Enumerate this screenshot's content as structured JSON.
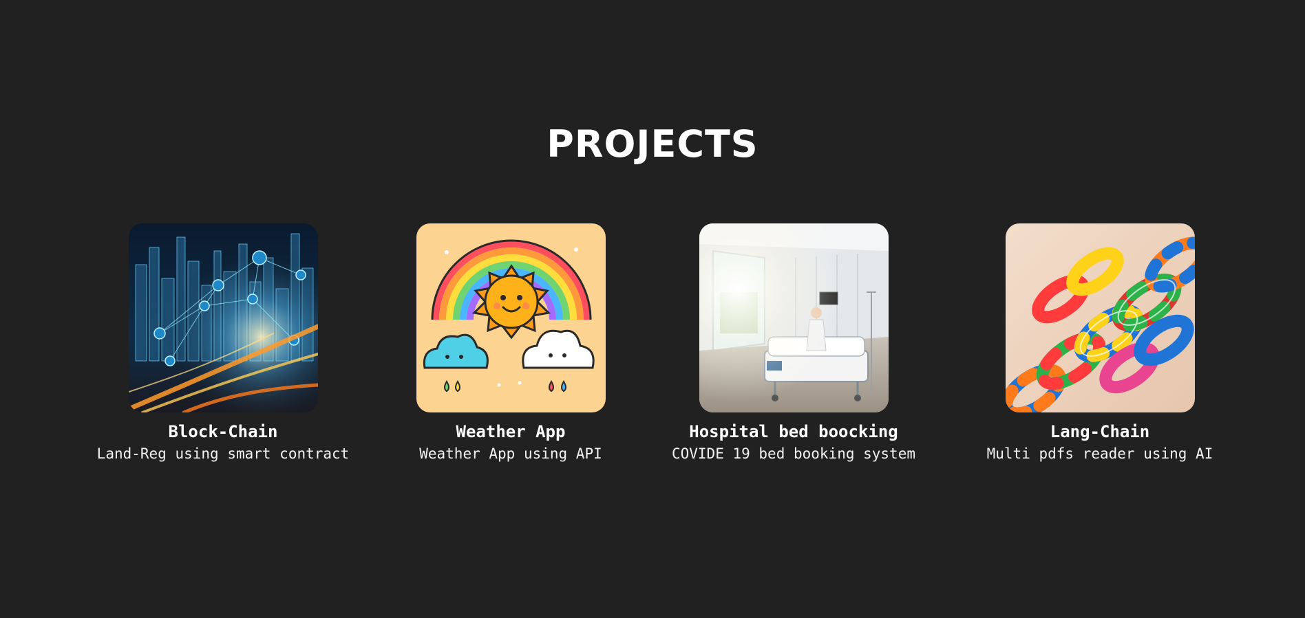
{
  "section": {
    "title": "PROJECTS"
  },
  "projects": [
    {
      "title": "Block-Chain",
      "description": "Land-Reg using smart contract",
      "image_icon": "futuristic-city-network-image"
    },
    {
      "title": "Weather App",
      "description": "Weather App using API",
      "image_icon": "rainbow-sun-clouds-image"
    },
    {
      "title": "Hospital bed boocking",
      "description": "COVIDE 19 bed booking system",
      "image_icon": "hospital-room-image"
    },
    {
      "title": "Lang-Chain",
      "description": "Multi pdfs reader using AI",
      "image_icon": "colorful-chain-links-image"
    }
  ],
  "colors": {
    "background": "#212121",
    "text": "#ffffff"
  }
}
